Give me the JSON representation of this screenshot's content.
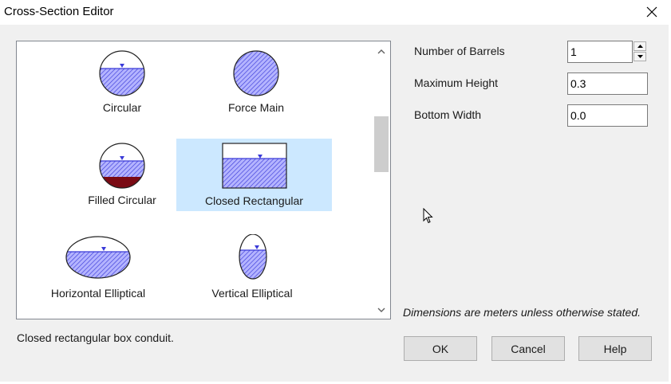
{
  "window": {
    "title": "Cross-Section Editor"
  },
  "shapes": [
    {
      "label": "Circular",
      "icon": "circular-shape-icon"
    },
    {
      "label": "Force Main",
      "icon": "force-main-shape-icon"
    },
    {
      "label": "Filled Circular",
      "icon": "filled-circular-shape-icon"
    },
    {
      "label": "Closed Rectangular",
      "icon": "closed-rectangular-shape-icon",
      "selected": true
    },
    {
      "label": "Horizontal Elliptical",
      "icon": "horizontal-elliptical-shape-icon"
    },
    {
      "label": "Vertical Elliptical",
      "icon": "vertical-elliptical-shape-icon"
    }
  ],
  "fields": {
    "barrels": {
      "label": "Number of Barrels",
      "value": "1"
    },
    "max_height": {
      "label": "Maximum Height",
      "value": "0.3"
    },
    "bottom_width": {
      "label": "Bottom Width",
      "value": "0.0"
    }
  },
  "note": "Dimensions are meters unless otherwise stated.",
  "description": "Closed rectangular box conduit.",
  "buttons": {
    "ok": "OK",
    "cancel": "Cancel",
    "help": "Help"
  },
  "colors": {
    "selection": "#cce8ff",
    "hatch": "#3a3ad8",
    "fill": "#b4b4ff",
    "sediment": "#7a0a14"
  }
}
